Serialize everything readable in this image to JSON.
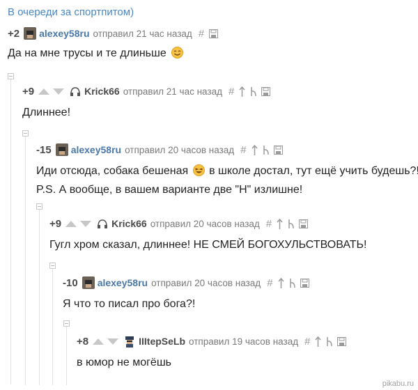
{
  "page": {
    "title": "В очереди за спортпитом)",
    "watermark": "pikabu.ru"
  },
  "comments": [
    {
      "rating": "+2",
      "user": "alexey58ru",
      "meta": "отправил 21 час назад",
      "text": "Да на мне трусы и те длиньше",
      "emoji": "smile"
    },
    {
      "rating": "+9",
      "user": "Krick66",
      "meta": "отправил 21 час назад",
      "text": "Длиннее!"
    },
    {
      "rating": "-15",
      "user": "alexey58ru",
      "meta": "отправил 20 часов назад",
      "text": "Иди отсюда, собака бешеная",
      "text_after": "в школе достал, тут ещё учить будешь?!",
      "text2": "P.S. А вообще, в вашем варианте две \"Н\" излишне!",
      "emoji": "laugh"
    },
    {
      "rating": "+9",
      "user": "Krick66",
      "meta": "отправил 20 часов назад",
      "text": "Гугл хром сказал, длиннее! НЕ СМЕЙ БОГОХУЛЬСТВОВАТЬ!"
    },
    {
      "rating": "-10",
      "user": "alexey58ru",
      "meta": "отправил 20 часов назад",
      "text": "Я что то писал про бога?!"
    },
    {
      "rating": "+8",
      "user": "IIItepSeLb",
      "meta": "отправил 19 часов назад",
      "text": "в юмор не могёшь"
    }
  ],
  "icons": {
    "link": "hash-icon",
    "save": "save-icon",
    "up": "arrow-up-icon",
    "parent": "parent-arrow-icon",
    "vote_up": "vote-up-icon",
    "vote_down": "vote-down-icon"
  },
  "colors": {
    "title": "#4a88c7",
    "username": "#4a78a8",
    "meta": "#7a7a7a",
    "vote": "#c7c7c7"
  }
}
